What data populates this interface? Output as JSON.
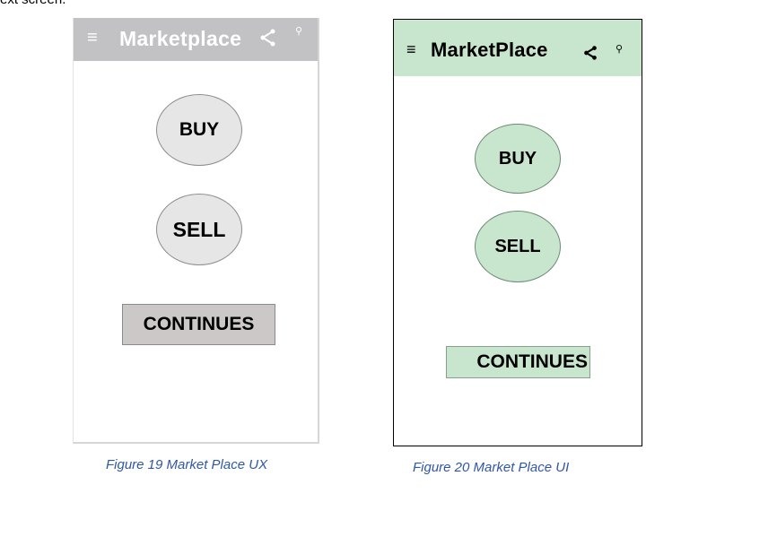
{
  "page": {
    "top_text": "ext screen."
  },
  "ux_mockup": {
    "app_bar": {
      "title": "Marketplace",
      "menu_icon": "menu-icon",
      "share_icon": "share-icon",
      "search_icon": "search-icon",
      "color": "#c2c2c4"
    },
    "buy_label": "BUY",
    "sell_label": "SELL",
    "continue_label": "CONTINUES",
    "caption": "Figure 19 Market Place UX"
  },
  "ui_mockup": {
    "app_bar": {
      "title": "MarketPlace",
      "menu_icon": "menu-icon",
      "share_icon": "share-icon",
      "search_icon": "search-icon",
      "color": "#c8e6cd"
    },
    "buy_label": "BUY",
    "sell_label": "SELL",
    "continue_label": "CONTINUES",
    "caption": "Figure 20 Market Place UI"
  }
}
